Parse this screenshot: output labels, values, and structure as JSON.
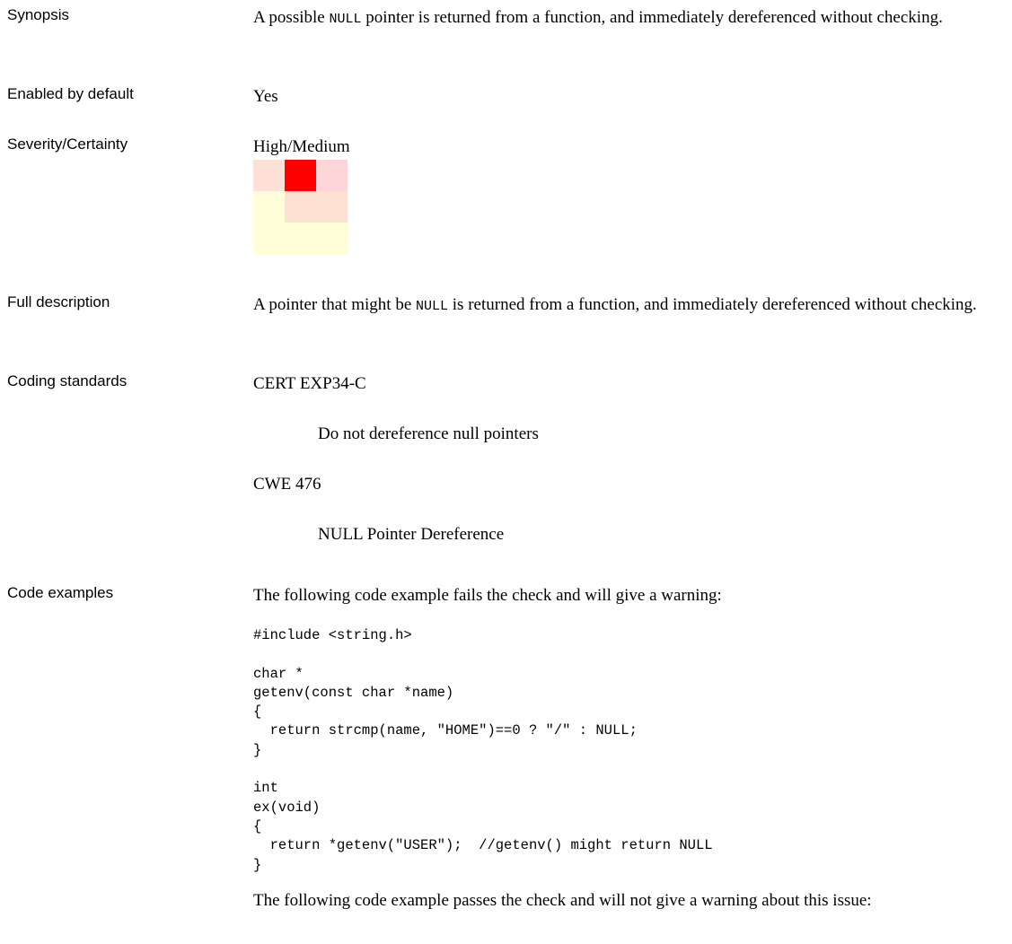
{
  "synopsis": {
    "label": "Synopsis",
    "text_before": "A possible ",
    "code": "NULL",
    "text_after": " pointer is returned from a function, and immediately dereferenced without checking."
  },
  "enabled": {
    "label": "Enabled by default",
    "value": "Yes"
  },
  "severity": {
    "label": "Severity/Certainty",
    "value": "High/Medium",
    "matrix_colors": [
      [
        "#fde0d6",
        "#ff0000",
        "#fdd5d8"
      ],
      [
        "#fffed8",
        "#fde2d4",
        "#fde2d4"
      ],
      [
        "#fffed8",
        "#fffed8",
        "#fffed8"
      ]
    ]
  },
  "full_description": {
    "label": "Full description",
    "text_before": "A pointer that might be ",
    "code": "NULL",
    "text_after": " is returned from a function, and immediately dereferenced without checking."
  },
  "coding_standards": {
    "label": "Coding standards",
    "items": [
      {
        "name": "CERT EXP34-C",
        "description": "Do not dereference null pointers"
      },
      {
        "name": "CWE 476",
        "description": "NULL Pointer Dereference"
      }
    ]
  },
  "code_examples": {
    "label": "Code examples",
    "fail_intro": "The following code example fails the check and will give a warning:",
    "fail_code": "#include <string.h>\n\nchar *\ngetenv(const char *name)\n{\n  return strcmp(name, \"HOME\")==0 ? \"/\" : NULL;\n}\n\nint\nex(void)\n{\n  return *getenv(\"USER\");  //getenv() might return NULL\n}",
    "pass_intro": "The following code example passes the check and will not give a warning about this issue:"
  }
}
